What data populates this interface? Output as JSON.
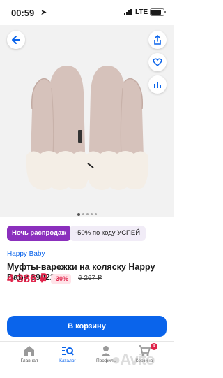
{
  "status_bar": {
    "time": "00:59",
    "location_arrow": "➤",
    "network": "LTE"
  },
  "hero": {
    "image_description": "pink-beige stroller mittens with fur cuffs",
    "pager_count": 5,
    "pager_active_index": 0
  },
  "promo": {
    "night_sale": "Ночь распродаж",
    "code_text": "-50% по коду УСПЕЙ"
  },
  "product": {
    "brand": "Happy Baby",
    "title": "Муфты-варежки на коляску Happy Baby 89022-6",
    "price": "4 386 ₽",
    "discount": "-30%",
    "old_price": "6 267 ₽"
  },
  "actions": {
    "add_to_cart": "В корзину"
  },
  "tabbar": {
    "items": [
      {
        "label": "Главная",
        "icon": "home-icon"
      },
      {
        "label": "Каталог",
        "icon": "catalog-search-icon"
      },
      {
        "label": "Профиль",
        "icon": "profile-icon"
      },
      {
        "label": "Корзина",
        "icon": "cart-icon",
        "badge": "4"
      }
    ]
  },
  "watermark": "Avito",
  "colors": {
    "accent": "#0a64eb",
    "price_red": "#e0234a",
    "sale_purple": "#8b2fbd"
  }
}
